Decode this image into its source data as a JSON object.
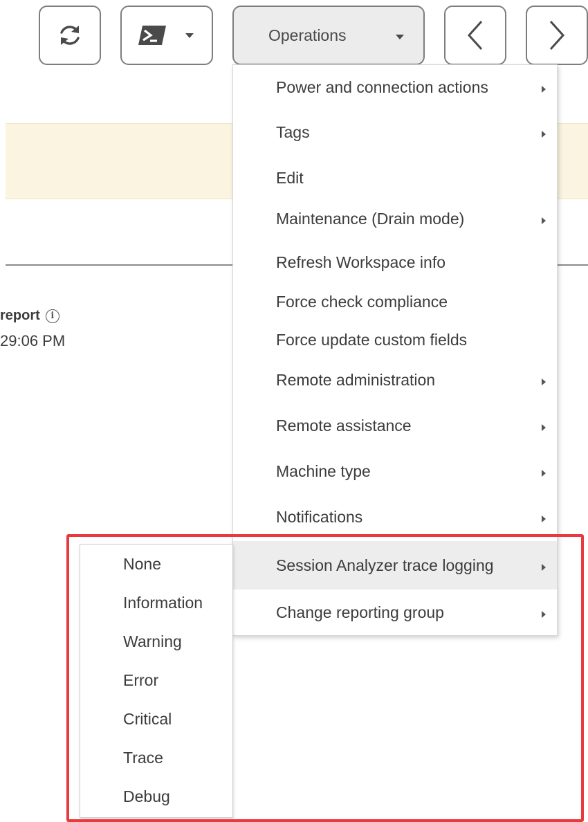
{
  "toolbar": {
    "refresh_icon": "refresh-icon",
    "powershell_icon": "powershell-icon",
    "operations_label": "Operations",
    "prev_icon": "chevron-left-icon",
    "next_icon": "chevron-right-icon"
  },
  "background": {
    "report_label": "report",
    "report_time": "29:06 PM"
  },
  "menu": {
    "items": [
      {
        "label": "Power and connection actions",
        "has_submenu": true
      },
      {
        "label": "Tags",
        "has_submenu": true
      },
      {
        "label": "Edit",
        "has_submenu": false
      },
      {
        "label": "Maintenance (Drain mode)",
        "has_submenu": true
      },
      {
        "label": "Refresh Workspace info",
        "has_submenu": false
      },
      {
        "label": "Force check compliance",
        "has_submenu": false
      },
      {
        "label": "Force update custom fields",
        "has_submenu": false
      },
      {
        "label": "Remote administration",
        "has_submenu": true
      },
      {
        "label": "Remote assistance",
        "has_submenu": true
      },
      {
        "label": "Machine type",
        "has_submenu": true
      },
      {
        "label": "Notifications",
        "has_submenu": true
      },
      {
        "label": "Session Analyzer trace logging",
        "has_submenu": true,
        "active": true
      },
      {
        "label": "Change reporting group",
        "has_submenu": true
      }
    ]
  },
  "submenu": {
    "items": [
      "None",
      "Information",
      "Warning",
      "Error",
      "Critical",
      "Trace",
      "Debug"
    ]
  },
  "colors": {
    "highlight": "#e8393e",
    "banner": "#fbf4e1",
    "active_item": "#ededed"
  }
}
